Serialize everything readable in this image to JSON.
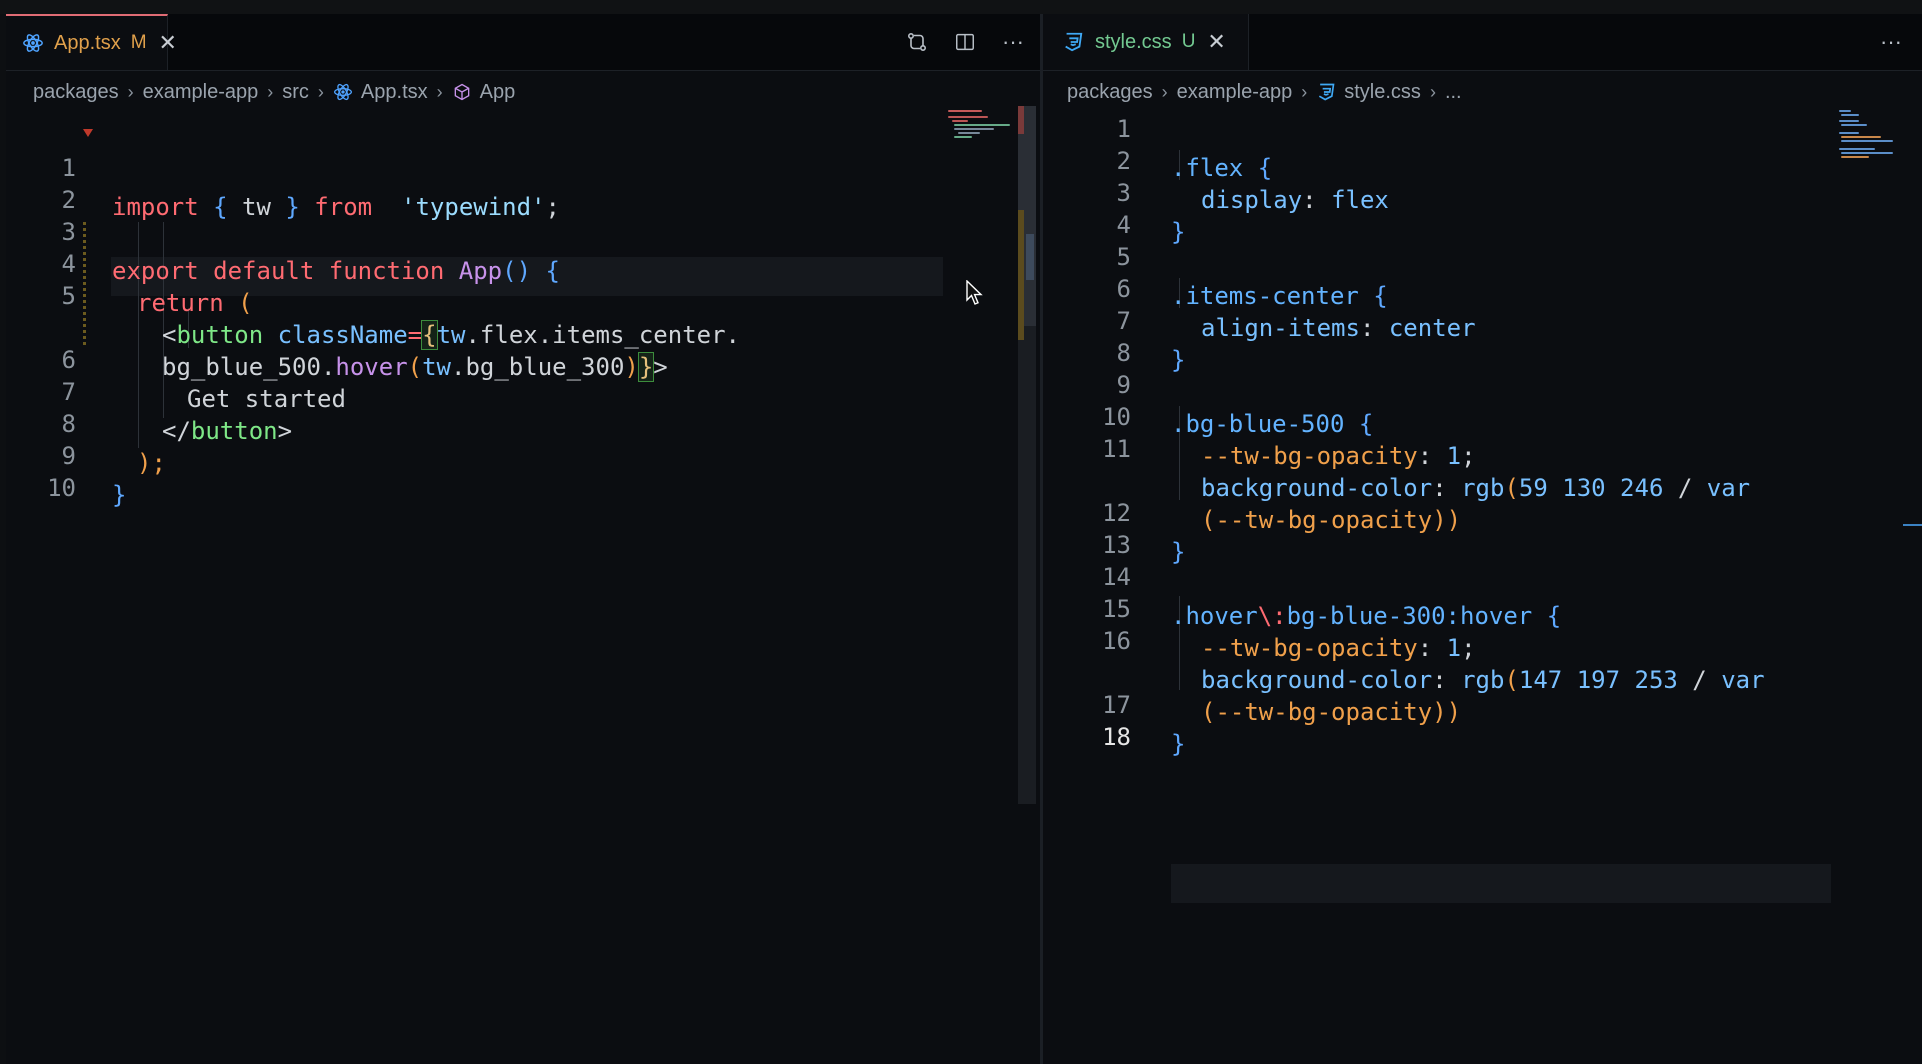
{
  "left": {
    "tab": {
      "label": "App.tsx",
      "status": "M",
      "icon": "react-icon",
      "close_icon": "close-icon"
    },
    "actions": [
      "compare-changes-icon",
      "split-editor-icon",
      "more-actions-icon"
    ],
    "breadcrumb": [
      "packages",
      "example-app",
      "src",
      "App.tsx",
      "App"
    ],
    "line_numbers": [
      "1",
      "2",
      "3",
      "4",
      "5",
      "",
      "6",
      "7",
      "8",
      "9",
      "10"
    ]
  },
  "right": {
    "tab": {
      "label": "style.css",
      "status": "U",
      "icon": "css-icon",
      "close_icon": "close-icon"
    },
    "actions": [
      "more-actions-icon"
    ],
    "breadcrumb": [
      "packages",
      "example-app",
      "style.css",
      "..."
    ],
    "line_numbers": [
      "1",
      "2",
      "3",
      "4",
      "5",
      "6",
      "7",
      "8",
      "9",
      "10",
      "11",
      "",
      "12",
      "13",
      "14",
      "15",
      "16",
      "",
      "17",
      "18"
    ]
  },
  "code": {
    "l1": {
      "import": "import",
      "b1": "{",
      "tw": " tw ",
      "b2": "}",
      "from": " from ",
      "str": "'typewind'",
      "semi": ";"
    },
    "l3": {
      "export": "export default function ",
      "fn": "App",
      "paren": "()",
      "brace": " {"
    },
    "l4": {
      "ret": "return",
      "paren": " ("
    },
    "l5": {
      "lt": "<",
      "tag": "button",
      "attr": " className",
      "eq": "=",
      "b": "{",
      "tw": "tw",
      "rest": ".flex.items_center."
    },
    "l5b": {
      "a": "bg_blue_500.",
      "hover": "hover",
      "p1": "(",
      "tw": "tw",
      "b": ".bg_blue_300",
      "p2": ")",
      "cb": "}",
      "gt": ">"
    },
    "l6": {
      "text": "Get started"
    },
    "l7": {
      "lt": "</",
      "tag": "button",
      "gt": ">"
    },
    "l8": {
      "text": ");"
    },
    "l9": {
      "text": "}"
    }
  },
  "css": {
    "c1": {
      "sel": ".flex",
      "b": " {"
    },
    "c2": {
      "prop": "display",
      "colon": ": ",
      "val": "flex"
    },
    "c3": {
      "b": "}"
    },
    "c5": {
      "sel": ".items-center",
      "b": " {"
    },
    "c6": {
      "prop": "align-items",
      "colon": ": ",
      "val": "center"
    },
    "c7": {
      "b": "}"
    },
    "c9": {
      "sel": ".bg-blue-500",
      "b": " {"
    },
    "c10": {
      "var": "--tw-bg-opacity",
      "colon": ": ",
      "num": "1",
      "semi": ";"
    },
    "c11": {
      "prop": "background-color",
      "colon": ": ",
      "fn": "rgb",
      "p": "(",
      "nums": "59 130 246",
      "slash": " / ",
      "v": "var"
    },
    "c11b": {
      "p": "(",
      "var": "--tw-bg-opacity",
      "pp": "))"
    },
    "c12": {
      "b": "}"
    },
    "c14": {
      "sel": ".hover",
      "esc": "\\:",
      "sel2": "bg-blue-300:hover",
      "b": " {"
    },
    "c15": {
      "var": "--tw-bg-opacity",
      "colon": ": ",
      "num": "1",
      "semi": ";"
    },
    "c16": {
      "prop": "background-color",
      "colon": ": ",
      "fn": "rgb",
      "p": "(",
      "nums": "147 197 253",
      "slash": " / ",
      "v": "var"
    },
    "c16b": {
      "p": "(",
      "var": "--tw-bg-opacity",
      "pp": "))"
    },
    "c17": {
      "b": "}"
    }
  },
  "colors": {
    "accent": "#e06c75",
    "modified": "#e0a04b",
    "untracked": "#73c991"
  }
}
